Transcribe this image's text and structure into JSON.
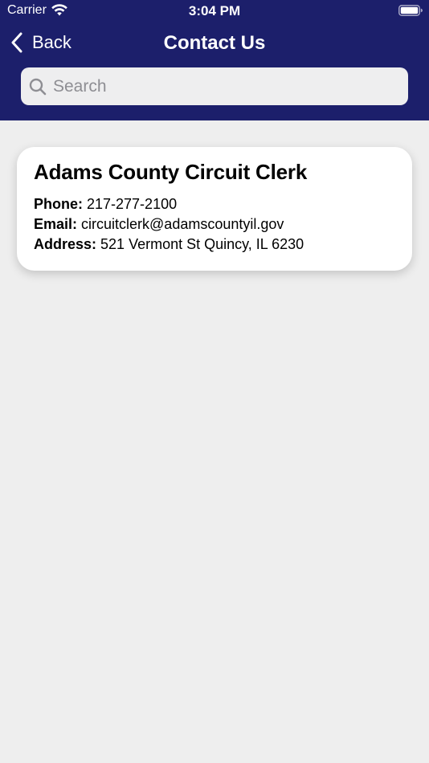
{
  "status_bar": {
    "carrier": "Carrier",
    "time": "3:04 PM"
  },
  "nav": {
    "back_label": "Back",
    "title": "Contact Us"
  },
  "search": {
    "placeholder": "Search",
    "value": ""
  },
  "contacts": [
    {
      "name": "Adams County Circuit Clerk",
      "phone_label": "Phone:",
      "phone": "217-277-2100",
      "email_label": "Email:",
      "email": "circuitclerk@adamscountyil.gov",
      "address_label": "Address:",
      "address": "521 Vermont St Quincy, IL 6230"
    }
  ],
  "colors": {
    "header_bg": "#1c1f6b",
    "page_bg": "#eeeeee",
    "card_bg": "#ffffff"
  }
}
